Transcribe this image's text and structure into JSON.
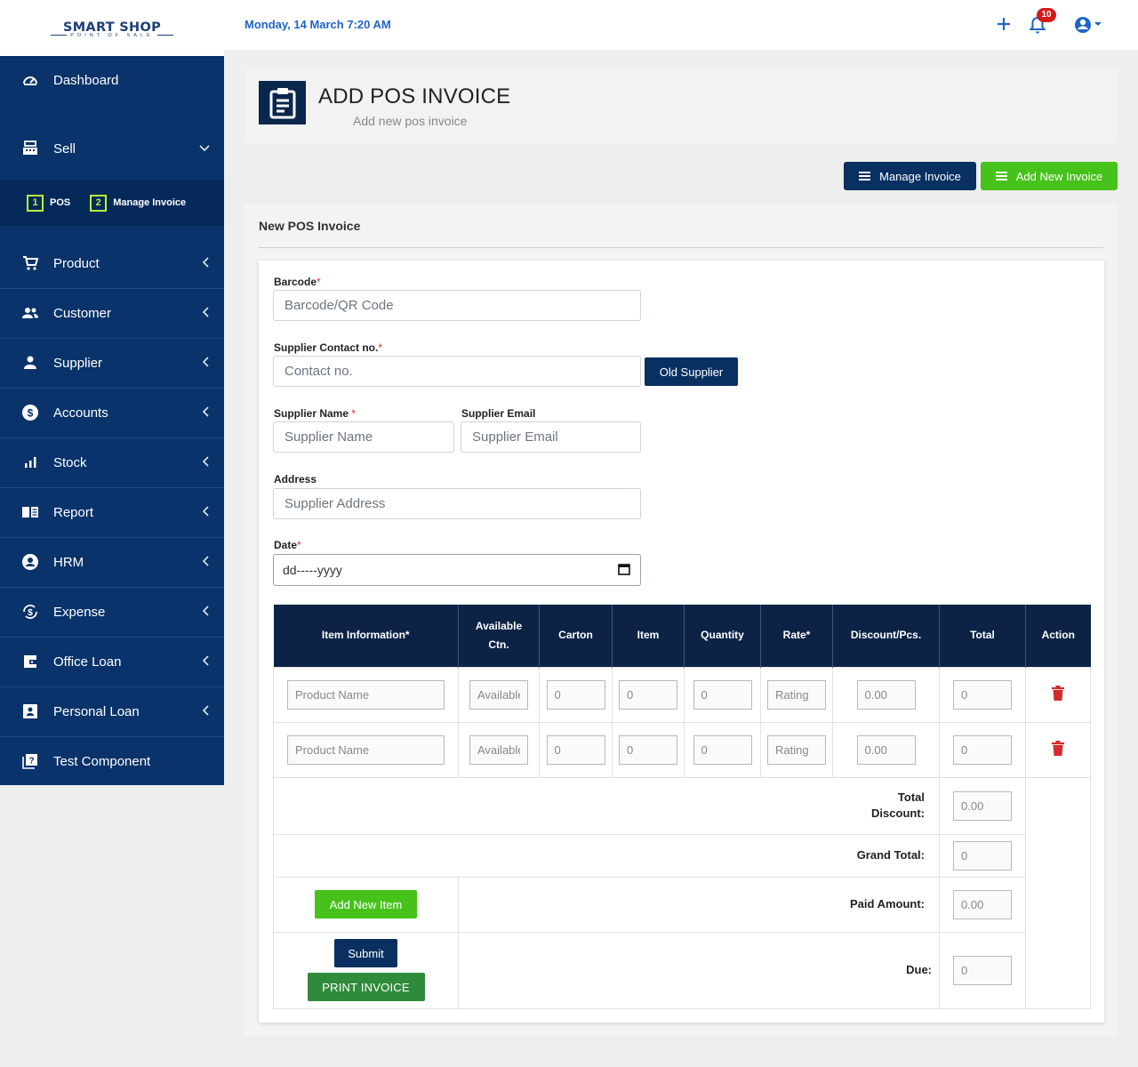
{
  "brand": {
    "title": "SMART SHOP",
    "subtitle": "POINT OF SALE"
  },
  "topbar": {
    "date": "Monday, 14 March 7:20 AM",
    "notification_count": "10"
  },
  "sidebar": {
    "items": [
      {
        "label": "Dashboard",
        "icon": "gauge-icon"
      },
      {
        "label": "Sell",
        "icon": "cash-register-icon"
      },
      {
        "label": "Product",
        "icon": "cart-icon"
      },
      {
        "label": "Customer",
        "icon": "people-icon"
      },
      {
        "label": "Supplier",
        "icon": "person-icon"
      },
      {
        "label": "Accounts",
        "icon": "dollar-circle-icon"
      },
      {
        "label": "Stock",
        "icon": "bar-chart-icon"
      },
      {
        "label": "Report",
        "icon": "book-icon"
      },
      {
        "label": "HRM",
        "icon": "account-circle-icon"
      },
      {
        "label": "Expense",
        "icon": "money-cycle-icon"
      },
      {
        "label": "Office Loan",
        "icon": "wallet-icon"
      },
      {
        "label": "Personal Loan",
        "icon": "badge-icon"
      },
      {
        "label": "Test Component",
        "icon": "help-box-icon"
      }
    ],
    "sell_submenu": [
      {
        "num": "1",
        "label": "POS"
      },
      {
        "num": "2",
        "label": "Manage Invoice"
      }
    ]
  },
  "header": {
    "title": "ADD POS INVOICE",
    "subtitle": "Add new pos invoice"
  },
  "actions": {
    "manage_invoice": "Manage Invoice",
    "add_new_invoice": "Add New Invoice"
  },
  "card": {
    "title": "New POS Invoice"
  },
  "form": {
    "barcode_label": "Barcode",
    "barcode_placeholder": "Barcode/QR Code",
    "contact_label": "Supplier Contact no.",
    "contact_placeholder": "Contact no.",
    "old_supplier": "Old Supplier",
    "name_label": "Supplier Name",
    "name_placeholder": "Supplier Name",
    "email_label": "Supplier Email",
    "email_placeholder": "Supplier Email",
    "address_label": "Address",
    "address_placeholder": "Supplier Address",
    "date_label": "Date",
    "date_value": "dd-----yyyy",
    "required_mark": "*"
  },
  "table": {
    "headers": {
      "item_info": "Item Information*",
      "available_1": "Available",
      "available_2": "Ctn.",
      "carton": "Carton",
      "item": "Item",
      "quantity": "Quantity",
      "rate": "Rate*",
      "discount": "Discount/Pcs.",
      "total": "Total",
      "action": "Action"
    },
    "row_placeholders": {
      "product": "Product Name",
      "available": "Available",
      "zero": "0",
      "rate": "Rating",
      "discount": "0.00"
    },
    "totals": {
      "total_discount_1": "Total",
      "total_discount_2": "Discount:",
      "total_discount_value": "0.00",
      "grand_total": "Grand Total:",
      "grand_total_value": "0",
      "paid_amount": "Paid Amount:",
      "paid_amount_value": "0.00",
      "due": "Due:",
      "due_value": "0"
    },
    "buttons": {
      "add_item": "Add New Item",
      "submit": "Submit",
      "print": "PRINT INVOICE"
    }
  },
  "colors": {
    "sidebar": "#09336a",
    "accent_blue": "#093061",
    "accent_green": "#46c21b",
    "link_blue": "#1f63c6",
    "danger": "#d22c2c"
  }
}
